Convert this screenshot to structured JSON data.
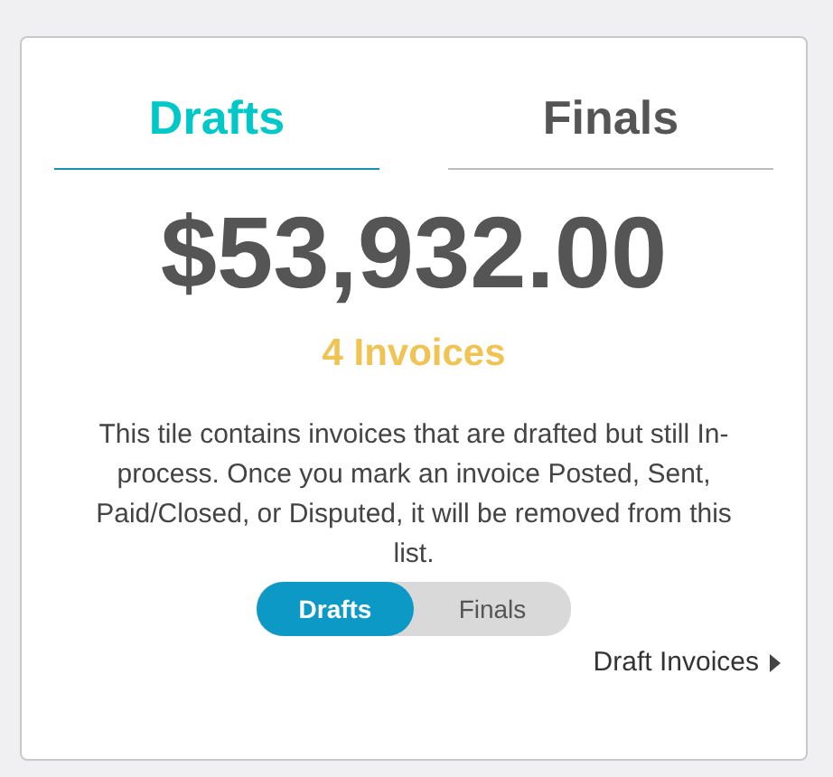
{
  "tabs": [
    {
      "label": "Drafts",
      "selected": true
    },
    {
      "label": "Finals",
      "selected": false
    }
  ],
  "amount": "$53,932.00",
  "invoice_count": "4 Invoices",
  "description": "This tile contains invoices that are drafted but still In-process. Once you mark an invoice Posted, Sent, Paid/Closed, or Disputed, it will be removed from this list.",
  "toggle": [
    {
      "label": "Drafts",
      "selected": true
    },
    {
      "label": "Finals",
      "selected": false
    }
  ],
  "link": "Draft Invoices"
}
